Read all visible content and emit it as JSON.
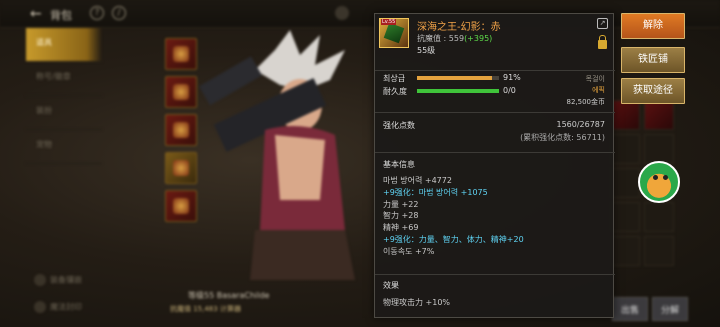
{
  "topbar": {
    "back_icon": "arrow-left-icon",
    "title": "背包"
  },
  "sidebar": {
    "items": [
      {
        "label": "道具",
        "active": true
      },
      {
        "label": "称号/徽章",
        "active": false
      },
      {
        "label": "装扮",
        "active": false
      },
      {
        "label": "宠物",
        "active": false
      }
    ],
    "bottom_items": [
      "装备镶嵌",
      "魔法封印"
    ]
  },
  "character": {
    "name": "等级55 BasaraChilde",
    "power": "抗魔值 15,483  计算器"
  },
  "tooltip": {
    "item_name": "深海之王-幻影：赤",
    "icon_badge": "Lv.55",
    "anti_magic_label": "抗魔值 : 559",
    "anti_magic_bonus": "(+395)",
    "level": "55级",
    "grade_label": "최상급",
    "grade_percent": "91%",
    "grade_value": 0.91,
    "grade_color": "#e5a33e",
    "durability_label": "耐久度",
    "durability_value": "0/0",
    "durability_fill": 1.0,
    "durability_color": "#3fc43a",
    "slot_type": "목걸이",
    "rarity": "에픽",
    "price": "82,500金币",
    "strengthen_label": "强化点数",
    "strengthen_value": "1560/26787",
    "strengthen_total": "(累积强化点数: 56711)",
    "basic_info_title": "基本信息",
    "stats": [
      {
        "text": "마법 방어력 +4772",
        "enhanced": false
      },
      {
        "text": "+9强化：마법 방어력 +1075",
        "enhanced": true
      },
      {
        "text": "力量 +22",
        "enhanced": false
      },
      {
        "text": "智力 +28",
        "enhanced": false
      },
      {
        "text": "精神 +69",
        "enhanced": false
      },
      {
        "text": "+9强化：力量、智力、体力、精神+20",
        "enhanced": true
      },
      {
        "text": "이동속도 +7%",
        "enhanced": false
      }
    ],
    "effect_title": "效果",
    "effect_line": "物理攻击力 +10%"
  },
  "actions": {
    "release": "解除",
    "blacksmith": "铁匠铺",
    "obtain": "获取途径"
  },
  "bottom_buttons": [
    "出售",
    "分解"
  ]
}
